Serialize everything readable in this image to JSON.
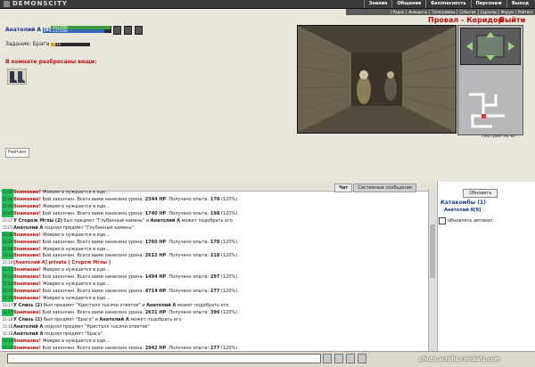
{
  "header": {
    "logo": "DEMONSCITY",
    "nav": [
      "Знания",
      "Общение",
      "Безопасность",
      "Персонаж",
      "Выход"
    ],
    "subnav": [
      "Радио",
      "Анекдоты",
      "Телеграммы",
      "События",
      "Скроллы",
      "Форум",
      "Рейтинг"
    ]
  },
  "player": {
    "name": "Анатолий А",
    "level": "[9]",
    "hp_text": "465/468",
    "mp_text": "237/268",
    "hp_fraction": 0.99,
    "mp_fraction": 0.88,
    "task_label": "Задание: Брага",
    "task_progress_text": "1/10",
    "task_fraction": 0.1
  },
  "room": {
    "items_title": "В комнате разбросаны вещи:",
    "item_icon": "boots-icon",
    "rating_label": "Рейтинг"
  },
  "location": {
    "title": "Провал - Коридор",
    "exit_label": "Выйти",
    "facing_label": "смотрим на юг"
  },
  "chat": {
    "tabs": [
      "Чат",
      "Системные сообщения"
    ],
    "messages": [
      {
        "time": "15:05",
        "highlight": true,
        "parts": [
          {
            "k": "warn",
            "t": "Внимание!"
          },
          {
            "k": "n",
            "t": " Жеврюга нуждается в еде..."
          }
        ]
      },
      {
        "time": "15:06",
        "highlight": true,
        "parts": [
          {
            "k": "warn",
            "t": "Внимание!"
          },
          {
            "k": "n",
            "t": " Бой закончен. Всего вами нанесено урона: "
          },
          {
            "k": "b",
            "t": "2344 HP"
          },
          {
            "k": "n",
            "t": ". Получено опыта: "
          },
          {
            "k": "b",
            "t": "178"
          },
          {
            "k": "n",
            "t": " (120%)."
          }
        ]
      },
      {
        "time": "15:06",
        "highlight": true,
        "parts": [
          {
            "k": "warn",
            "t": "Внимание!"
          },
          {
            "k": "n",
            "t": " Жеврюга нуждается в еде..."
          }
        ]
      },
      {
        "time": "15:07",
        "highlight": true,
        "parts": [
          {
            "k": "warn",
            "t": "Внимание!"
          },
          {
            "k": "n",
            "t": " Бой закончен. Всего вами нанесено урона: "
          },
          {
            "k": "b",
            "t": "1740 HP"
          },
          {
            "k": "n",
            "t": ". Получено опыта: "
          },
          {
            "k": "b",
            "t": "198"
          },
          {
            "k": "n",
            "t": " (120%)."
          }
        ]
      },
      {
        "time": "15:07",
        "highlight": false,
        "parts": [
          {
            "k": "b",
            "t": "У Сторож Мглы (2)"
          },
          {
            "k": "n",
            "t": " был предмет \"Глубинный камень\" и "
          },
          {
            "k": "b",
            "t": "Анатолий А"
          },
          {
            "k": "n",
            "t": " может подобрать его"
          }
        ]
      },
      {
        "time": "15:07",
        "highlight": false,
        "parts": [
          {
            "k": "b",
            "t": "Анатолий А"
          },
          {
            "k": "n",
            "t": " поднял предмет \"Глубинный камень\""
          }
        ]
      },
      {
        "time": "15:08",
        "highlight": true,
        "parts": [
          {
            "k": "warn",
            "t": "Внимание!"
          },
          {
            "k": "n",
            "t": " Жеврюга нуждается в еде..."
          }
        ]
      },
      {
        "time": "15:09",
        "highlight": true,
        "parts": [
          {
            "k": "warn",
            "t": "Внимание!"
          },
          {
            "k": "n",
            "t": " Бой закончен. Всего вами нанесено урона: "
          },
          {
            "k": "b",
            "t": "1760 HP"
          },
          {
            "k": "n",
            "t": ". Получено опыта: "
          },
          {
            "k": "b",
            "t": "178"
          },
          {
            "k": "n",
            "t": " (120%)."
          }
        ]
      },
      {
        "time": "15:09",
        "highlight": true,
        "parts": [
          {
            "k": "warn",
            "t": "Внимание!"
          },
          {
            "k": "n",
            "t": " Жеврюга нуждается в еде..."
          }
        ]
      },
      {
        "time": "15:10",
        "highlight": true,
        "parts": [
          {
            "k": "warn",
            "t": "Внимание!"
          },
          {
            "k": "n",
            "t": " Бой закончен. Всего вами нанесено урона: "
          },
          {
            "k": "b",
            "t": "2612 HP"
          },
          {
            "k": "n",
            "t": ". Получено опыта: "
          },
          {
            "k": "b",
            "t": "218"
          },
          {
            "k": "n",
            "t": " (120%)."
          }
        ]
      },
      {
        "time": "15:10",
        "highlight": false,
        "parts": [
          {
            "k": "pr",
            "t": "[Анатолий А] private [ Сторож Мглы ]"
          }
        ]
      },
      {
        "time": "15:13",
        "highlight": true,
        "parts": [
          {
            "k": "warn",
            "t": "Внимание!"
          },
          {
            "k": "n",
            "t": " Жеврюга нуждается в еде..."
          }
        ]
      },
      {
        "time": "15:13",
        "highlight": true,
        "parts": [
          {
            "k": "warn",
            "t": "Внимание!"
          },
          {
            "k": "n",
            "t": " Бой закончен. Всего вами нанесено урона: "
          },
          {
            "k": "b",
            "t": "1494 HP"
          },
          {
            "k": "n",
            "t": ". Получено опыта: "
          },
          {
            "k": "b",
            "t": "297"
          },
          {
            "k": "n",
            "t": " (120%)."
          }
        ]
      },
      {
        "time": "15:14",
        "highlight": true,
        "parts": [
          {
            "k": "warn",
            "t": "Внимание!"
          },
          {
            "k": "n",
            "t": " Жеврюга нуждается в еде..."
          }
        ]
      },
      {
        "time": "15:15",
        "highlight": true,
        "parts": [
          {
            "k": "warn",
            "t": "Внимание!"
          },
          {
            "k": "n",
            "t": " Бой закончен. Всего вами нанесено урона: "
          },
          {
            "k": "b",
            "t": "4714 HP"
          },
          {
            "k": "n",
            "t": ". Получено опыта: "
          },
          {
            "k": "b",
            "t": "277"
          },
          {
            "k": "n",
            "t": " (120%)."
          }
        ]
      },
      {
        "time": "15:16",
        "highlight": true,
        "parts": [
          {
            "k": "warn",
            "t": "Внимание!"
          },
          {
            "k": "n",
            "t": " Жеврюга нуждается в еде..."
          }
        ]
      },
      {
        "time": "15:17",
        "highlight": false,
        "parts": [
          {
            "k": "b",
            "t": "У Слизь (2)"
          },
          {
            "k": "n",
            "t": " был предмет \"Кристалл тысячи ответов\" и "
          },
          {
            "k": "b",
            "t": "Анатолий А"
          },
          {
            "k": "n",
            "t": " может подобрать его"
          }
        ]
      },
      {
        "time": "15:17",
        "highlight": true,
        "parts": [
          {
            "k": "warn",
            "t": "Внимание!"
          },
          {
            "k": "n",
            "t": " Бой закончен. Всего вами нанесено урона: "
          },
          {
            "k": "b",
            "t": "2631 HP"
          },
          {
            "k": "n",
            "t": ". Получено опыта: "
          },
          {
            "k": "b",
            "t": "396"
          },
          {
            "k": "n",
            "t": " (120%)."
          }
        ]
      },
      {
        "time": "15:18",
        "highlight": false,
        "parts": [
          {
            "k": "b",
            "t": "У Слизь (2)"
          },
          {
            "k": "n",
            "t": " был предмет \"Брага\" и "
          },
          {
            "k": "b",
            "t": "Анатолий А"
          },
          {
            "k": "n",
            "t": " может подобрать его"
          }
        ]
      },
      {
        "time": "15:18",
        "highlight": false,
        "parts": [
          {
            "k": "b",
            "t": "Анатолий А"
          },
          {
            "k": "n",
            "t": " поднял предмет \"Кристалл тысячи ответов\""
          }
        ]
      },
      {
        "time": "15:18",
        "highlight": false,
        "parts": [
          {
            "k": "b",
            "t": "Анатолий А"
          },
          {
            "k": "n",
            "t": " поднял предмет \"Брага\""
          }
        ]
      },
      {
        "time": "15:19",
        "highlight": true,
        "parts": [
          {
            "k": "warn",
            "t": "Внимание!"
          },
          {
            "k": "n",
            "t": " Жеврюга нуждается в еде..."
          }
        ]
      },
      {
        "time": "15:20",
        "highlight": true,
        "parts": [
          {
            "k": "warn",
            "t": "Внимание!"
          },
          {
            "k": "n",
            "t": " Бой закончен. Всего вами нанесено урона: "
          },
          {
            "k": "b",
            "t": "2942 HP"
          },
          {
            "k": "n",
            "t": ". Получено опыта: "
          },
          {
            "k": "b",
            "t": "277"
          },
          {
            "k": "n",
            "t": " (120%)."
          }
        ]
      },
      {
        "time": "15:21",
        "highlight": false,
        "parts": [
          {
            "k": "b",
            "t": "У Сторож Мглы (2)"
          },
          {
            "k": "n",
            "t": " был предмет \"Сапоги Небесного Ветра\" и кто угодно может подобрать его"
          }
        ]
      }
    ]
  },
  "room_panel": {
    "refresh_label": "Обновить",
    "title": "Катакомбы (1)",
    "user": "Анатолий А[9]",
    "auto_label": "обновлять автомат."
  },
  "watermark": "photo.scrolls.combats.com"
}
